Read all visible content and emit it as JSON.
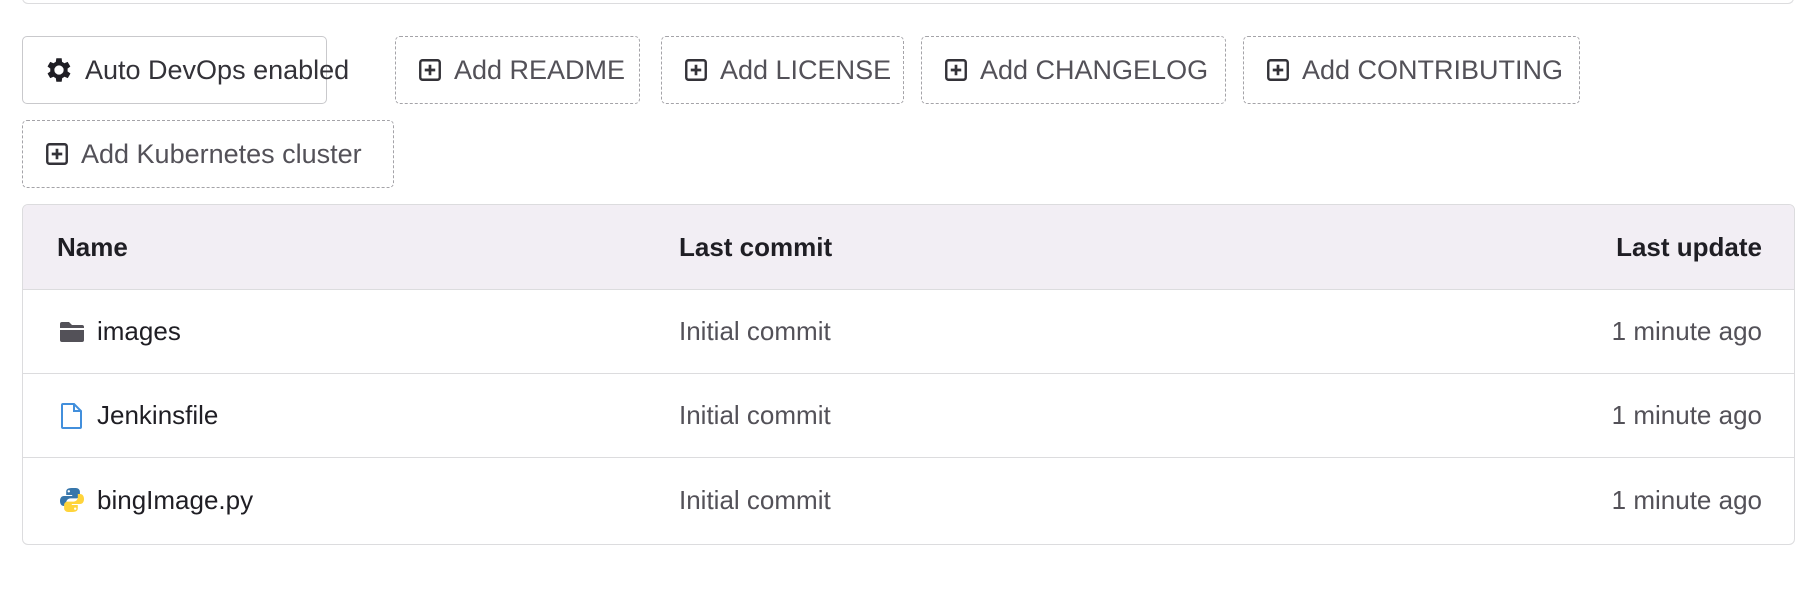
{
  "actions": {
    "auto_devops": {
      "label": "Auto DevOps enabled",
      "icon": "gear-icon"
    },
    "add_readme": {
      "label": "Add README",
      "icon": "plus-square-icon"
    },
    "add_license": {
      "label": "Add LICENSE",
      "icon": "plus-square-icon"
    },
    "add_changelog": {
      "label": "Add CHANGELOG",
      "icon": "plus-square-icon"
    },
    "add_contributing": {
      "label": "Add CONTRIBUTING",
      "icon": "plus-square-icon"
    },
    "add_kubernetes": {
      "label": "Add Kubernetes cluster",
      "icon": "plus-square-icon"
    }
  },
  "table": {
    "headers": {
      "name": "Name",
      "last_commit": "Last commit",
      "last_update": "Last update"
    },
    "rows": [
      {
        "name": "images",
        "icon": "folder-icon",
        "last_commit": "Initial commit",
        "last_update": "1 minute ago"
      },
      {
        "name": "Jenkinsfile",
        "icon": "file-icon",
        "last_commit": "Initial commit",
        "last_update": "1 minute ago"
      },
      {
        "name": "bingImage.py",
        "icon": "python-icon",
        "last_commit": "Initial commit",
        "last_update": "1 minute ago"
      }
    ]
  },
  "colors": {
    "header_bg": "#f2eef4",
    "border": "#dcdcde",
    "file_icon_blue": "#428fdc",
    "python_blue": "#3776ab",
    "python_yellow": "#ffd43b"
  }
}
